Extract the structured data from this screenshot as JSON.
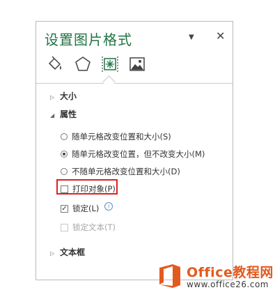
{
  "pane": {
    "title": "设置图片格式",
    "menu_icon": "dropdown-triangle",
    "close_icon": "close-x"
  },
  "tabs": [
    {
      "icon": "paint-bucket-icon"
    },
    {
      "icon": "pentagon-effects-icon"
    },
    {
      "icon": "size-properties-icon",
      "active": true
    },
    {
      "icon": "picture-icon"
    }
  ],
  "sections": {
    "size": {
      "label": "大小",
      "expanded": false
    },
    "properties": {
      "label": "属性",
      "expanded": true
    },
    "textbox": {
      "label": "文本框",
      "expanded": false
    }
  },
  "properties": {
    "radio1": "随单元格改变位置和大小(S)",
    "radio2": "随单元格改变位置，但不改变大小(M)",
    "radio3": "不随单元格改变位置和大小(D)",
    "selected_radio": 2,
    "print_object": {
      "label": "打印对象(P)",
      "checked": false
    },
    "locked": {
      "label": "锁定(L)",
      "checked": true
    },
    "lock_text": {
      "label": "锁定文本(T)",
      "checked": false,
      "disabled": true
    }
  },
  "watermark": {
    "brand": "Office教程网",
    "url": "www.office26.com"
  },
  "colors": {
    "accent": "#217346",
    "highlight_border": "#e02020",
    "brand_orange": "#e35a1f"
  }
}
